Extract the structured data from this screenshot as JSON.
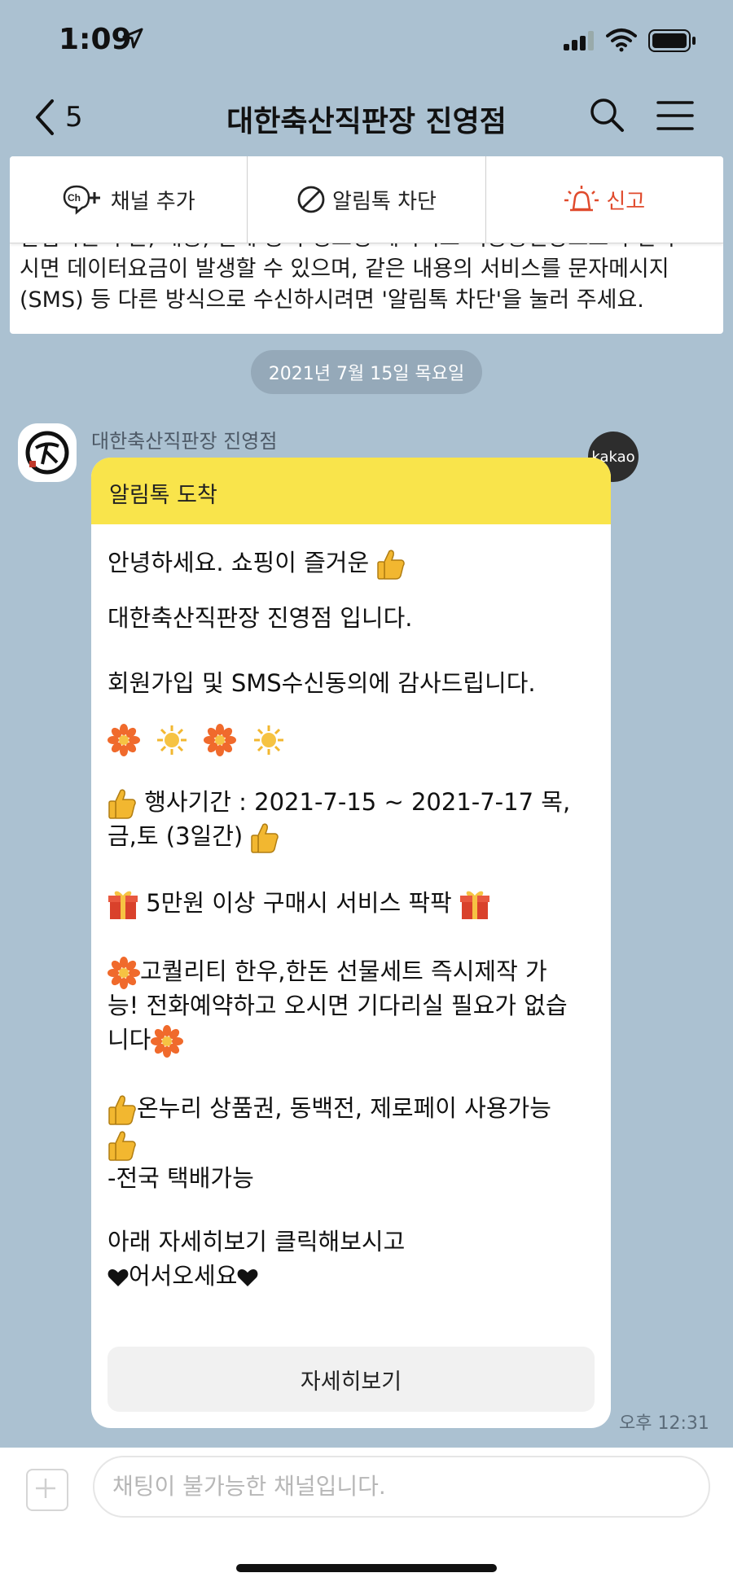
{
  "status": {
    "time": "1:09"
  },
  "nav": {
    "back_count": "5",
    "title": "대한축산직판장 진영점"
  },
  "notice": {
    "text_line1": "알림톡은 주문, 배송, 결제 등의 정보성 메시지로 이동통신망으로 수신하",
    "text_line2": "시면 데이터요금이 발생할 수 있으며, 같은 내용의 서비스를 문자메시지",
    "text_line3": "(SMS) 등 다른 방식으로 수신하시려면 '알림톡 차단'을 눌러 주세요.",
    "add_channel_label": "채널 추가",
    "block_label": "알림톡 차단",
    "report_label": "신고"
  },
  "date_separator": "2021년 7월 15일 목요일",
  "message": {
    "sender": "대한축산직판장 진영점",
    "badge": "kakao",
    "header": "알림톡 도착",
    "line1": "안녕하세요.  쇼핑이 즐거운",
    "line2": "대한축산직판장 진영점 입니다.",
    "line3": "회원가입 및 SMS수신동의에 감사드립니다.",
    "line4a": "행사기간 : 2021-7-15 ~ 2021-7-17 목,",
    "line4b": "금,토 (3일간)",
    "line5": "5만원 이상 구매시 서비스 팍팍",
    "line6a": "고퀄리티 한우,한돈 선물세트 즉시제작 가",
    "line6b": "능! 전화예약하고 오시면 기다리실 필요가 없습",
    "line6c": "니다",
    "line7a": "온누리 상품권, 동백전, 제로페이 사용가능",
    "line7b": " -전국 택배가능",
    "line8a": "아래 자세히보기 클릭해보시고",
    "line8b": "어서오세요",
    "button_label": "자세히보기",
    "time": "오후 12:31"
  },
  "input": {
    "placeholder": "채팅이 불가능한 채널입니다."
  },
  "colors": {
    "background": "#abc1d1",
    "header_yellow": "#f9e44b",
    "report_red": "#e04a2c"
  }
}
